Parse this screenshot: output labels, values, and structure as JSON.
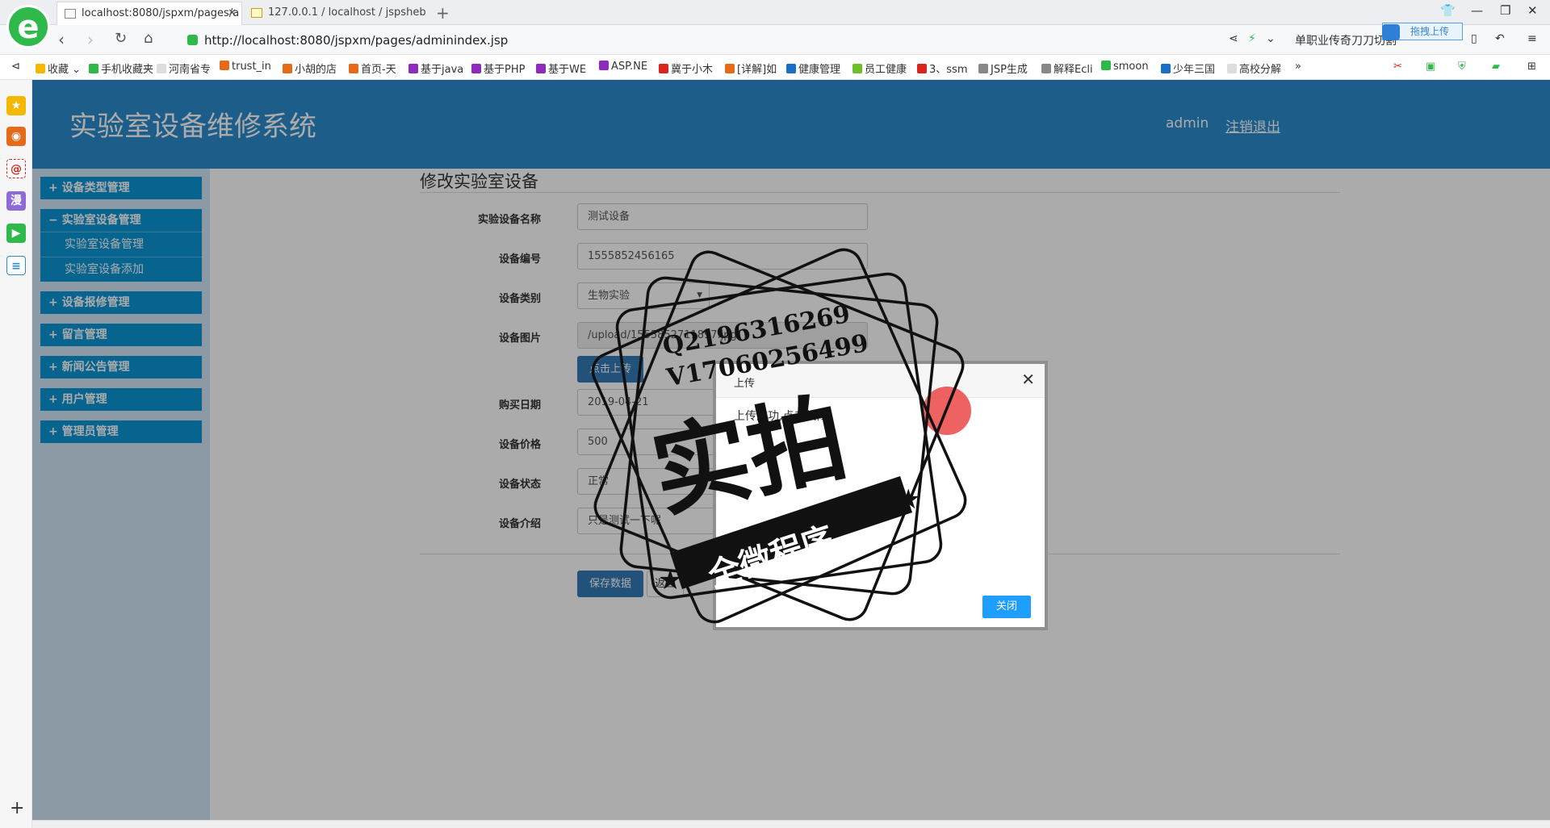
{
  "browser": {
    "tabs": [
      {
        "label": "localhost:8080/jspxm/pages/a"
      },
      {
        "label": "127.0.0.1 / localhost / jspsheb"
      }
    ],
    "url": "http://localhost:8080/jspxm/pages/adminindex.jsp",
    "addr_right_text": "单职业传奇刀刀切割",
    "drag_upload_label": "拖拽上传",
    "bookmarks": [
      "收藏",
      "手机收藏夹",
      "河南省专",
      "trust_in",
      "小胡的店",
      "首页-天",
      "基于java",
      "基于PHP",
      "基于WE",
      "ASP.NE",
      "冀于小木",
      "[详解]如",
      "健康管理",
      "员工健康",
      "3、ssm",
      "JSP生成",
      "解释Ecli",
      "smoon",
      "少年三国",
      "高校分解",
      "»"
    ],
    "sidebar_strip_icons": [
      "star-icon",
      "weibo-icon",
      "mail-icon",
      "manga-icon",
      "video-icon",
      "doc-icon"
    ]
  },
  "header": {
    "title": "实验室设备维修系统",
    "user": "admin",
    "logout": "注销退出"
  },
  "menu": [
    {
      "label": "+ 设备类型管理",
      "expanded": false,
      "items": []
    },
    {
      "label": "− 实验室设备管理",
      "expanded": true,
      "items": [
        "实验室设备管理",
        "实验室设备添加"
      ]
    },
    {
      "label": "+ 设备报修管理",
      "expanded": false,
      "items": []
    },
    {
      "label": "+ 留言管理",
      "expanded": false,
      "items": []
    },
    {
      "label": "+ 新闻公告管理",
      "expanded": false,
      "items": []
    },
    {
      "label": "+ 用户管理",
      "expanded": false,
      "items": []
    },
    {
      "label": "+ 管理员管理",
      "expanded": false,
      "items": []
    }
  ],
  "form": {
    "title": "修改实验室设备",
    "fields": {
      "name": {
        "label": "实验设备名称",
        "value": "测试设备"
      },
      "code": {
        "label": "设备编号",
        "value": "1555852456165"
      },
      "type": {
        "label": "设备类别",
        "value": "生物实验"
      },
      "image": {
        "label": "设备图片",
        "value": "/upload/1555852711897.jpg"
      },
      "date": {
        "label": "购买日期",
        "value": "2019-04-21"
      },
      "price": {
        "label": "设备价格",
        "value": "500"
      },
      "status": {
        "label": "设备状态",
        "value": "正常"
      },
      "intro": {
        "label": "设备介绍",
        "value": "只是测试一下呢"
      }
    },
    "upload_button": "点击上传",
    "save_button": "保存数据",
    "back_button": "返回"
  },
  "dialog": {
    "title": "上传",
    "message": "上传成功,点击关闭",
    "close_button": "关闭"
  },
  "watermark": {
    "line1": "Q2196316269",
    "line2": "V17060256499",
    "big_text": "实拍",
    "ribbon_text": "全微程序"
  }
}
